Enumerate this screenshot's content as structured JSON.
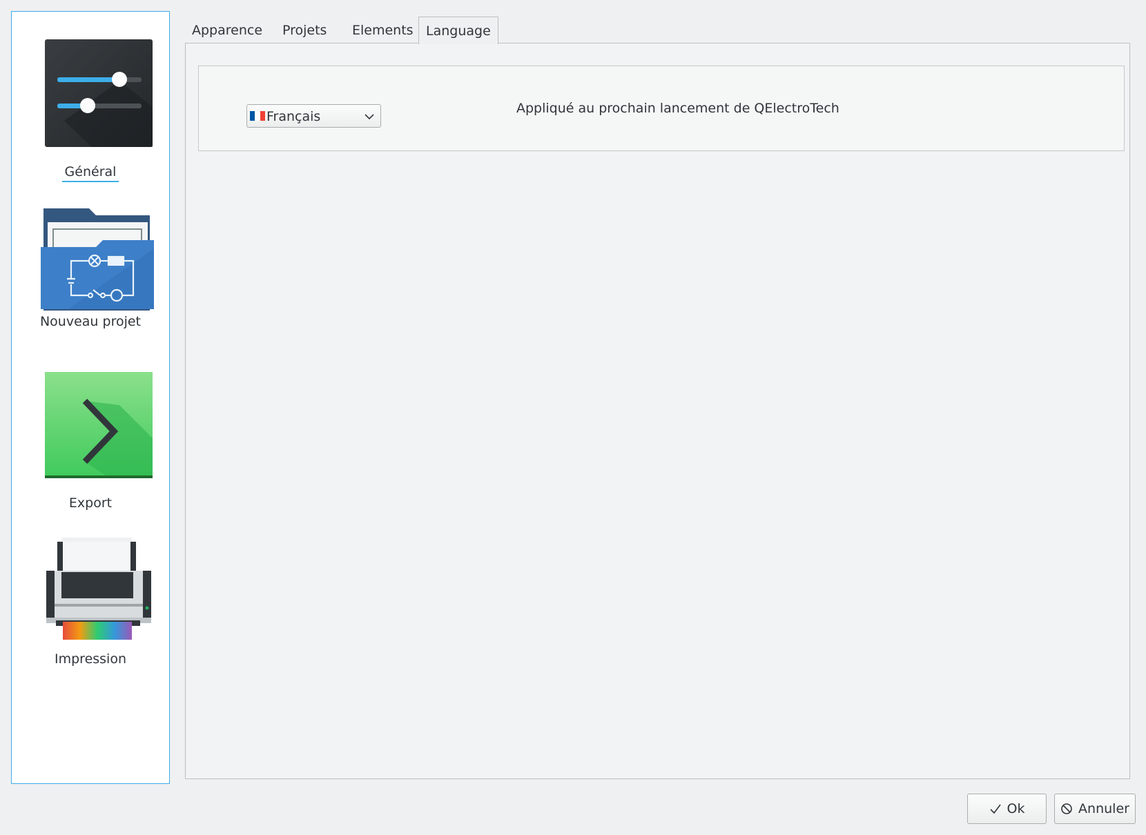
{
  "sidebar": {
    "items": [
      {
        "label": "Général",
        "icon": "sliders-icon",
        "active": true
      },
      {
        "label": "Nouveau projet",
        "icon": "project-folder-icon",
        "active": false
      },
      {
        "label": "Export",
        "icon": "export-arrow-icon",
        "active": false
      },
      {
        "label": "Impression",
        "icon": "printer-icon",
        "active": false
      }
    ]
  },
  "tabs": [
    {
      "label": "Apparence"
    },
    {
      "label": "Projets"
    },
    {
      "label": "Elements"
    },
    {
      "label": "Language"
    }
  ],
  "active_tab": "Language",
  "language": {
    "selected": "Français",
    "flag_icon": "france-flag-icon",
    "note": "Appliqué au prochain lancement de QElectroTech"
  },
  "buttons": {
    "ok": "Ok",
    "cancel": "Annuler"
  },
  "colors": {
    "accent": "#3daee9",
    "flag_blue": "#0055a4",
    "flag_white": "#ffffff",
    "flag_red": "#ef4135"
  }
}
